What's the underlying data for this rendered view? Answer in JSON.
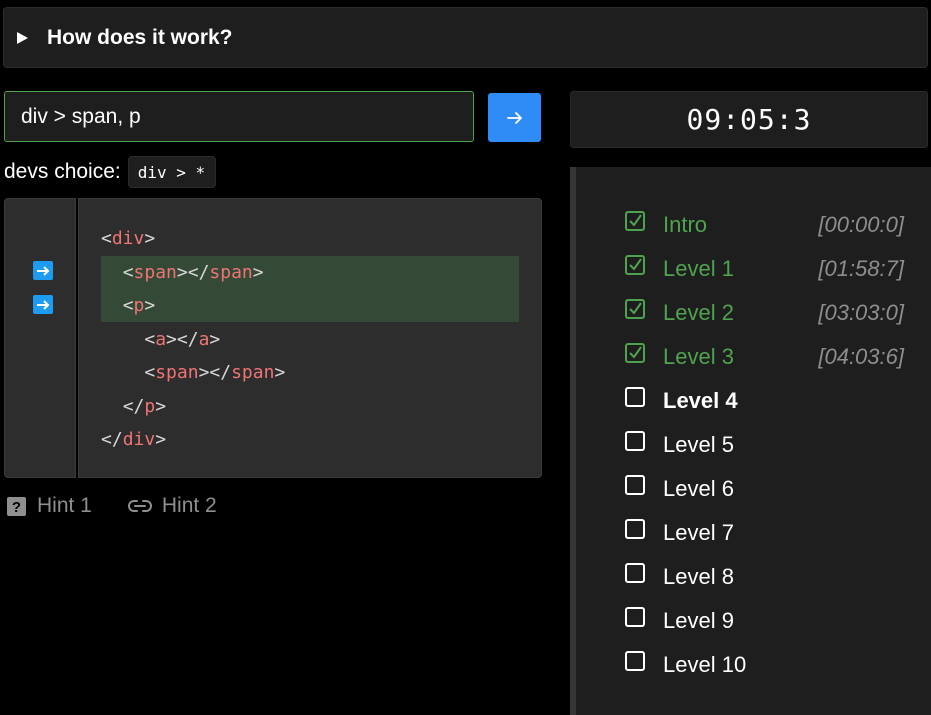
{
  "accordion": {
    "title": "How does it work?"
  },
  "selector": {
    "value": "div > span, p"
  },
  "devs_choice": {
    "label": "devs choice:",
    "code": "div > *"
  },
  "code": {
    "lines": [
      {
        "indent": "",
        "open": "<",
        "tag": "div",
        "mid": ">",
        "tag2": "",
        "close": ""
      },
      {
        "indent": "  ",
        "open": "<",
        "tag": "span",
        "mid": "></",
        "tag2": "span",
        "close": ">"
      },
      {
        "indent": "  ",
        "open": "<",
        "tag": "p",
        "mid": ">",
        "tag2": "",
        "close": ""
      },
      {
        "indent": "    ",
        "open": "<",
        "tag": "a",
        "mid": "></",
        "tag2": "a",
        "close": ">"
      },
      {
        "indent": "    ",
        "open": "<",
        "tag": "span",
        "mid": "></",
        "tag2": "span",
        "close": ">"
      },
      {
        "indent": "  ",
        "open": "</",
        "tag": "p",
        "mid": ">",
        "tag2": "",
        "close": ""
      },
      {
        "indent": "",
        "open": "</",
        "tag": "div",
        "mid": ">",
        "tag2": "",
        "close": ""
      }
    ]
  },
  "hints": {
    "hint1": "Hint 1",
    "hint2": "Hint 2"
  },
  "timer": {
    "value": "09:05:3"
  },
  "levels": [
    {
      "name": "Intro",
      "time": "[00:00:0]",
      "done": true
    },
    {
      "name": "Level 1",
      "time": "[01:58:7]",
      "done": true
    },
    {
      "name": "Level 2",
      "time": "[03:03:0]",
      "done": true
    },
    {
      "name": "Level 3",
      "time": "[04:03:6]",
      "done": true
    },
    {
      "name": "Level 4",
      "time": "",
      "done": false,
      "current": true
    },
    {
      "name": "Level 5",
      "time": "",
      "done": false
    },
    {
      "name": "Level 6",
      "time": "",
      "done": false
    },
    {
      "name": "Level 7",
      "time": "",
      "done": false
    },
    {
      "name": "Level 8",
      "time": "",
      "done": false
    },
    {
      "name": "Level 9",
      "time": "",
      "done": false
    },
    {
      "name": "Level 10",
      "time": "",
      "done": false
    }
  ],
  "colors": {
    "success": "#4fa34f",
    "accent": "#2f8cf6",
    "highlight": "#354937",
    "tag": "#ef7474"
  }
}
